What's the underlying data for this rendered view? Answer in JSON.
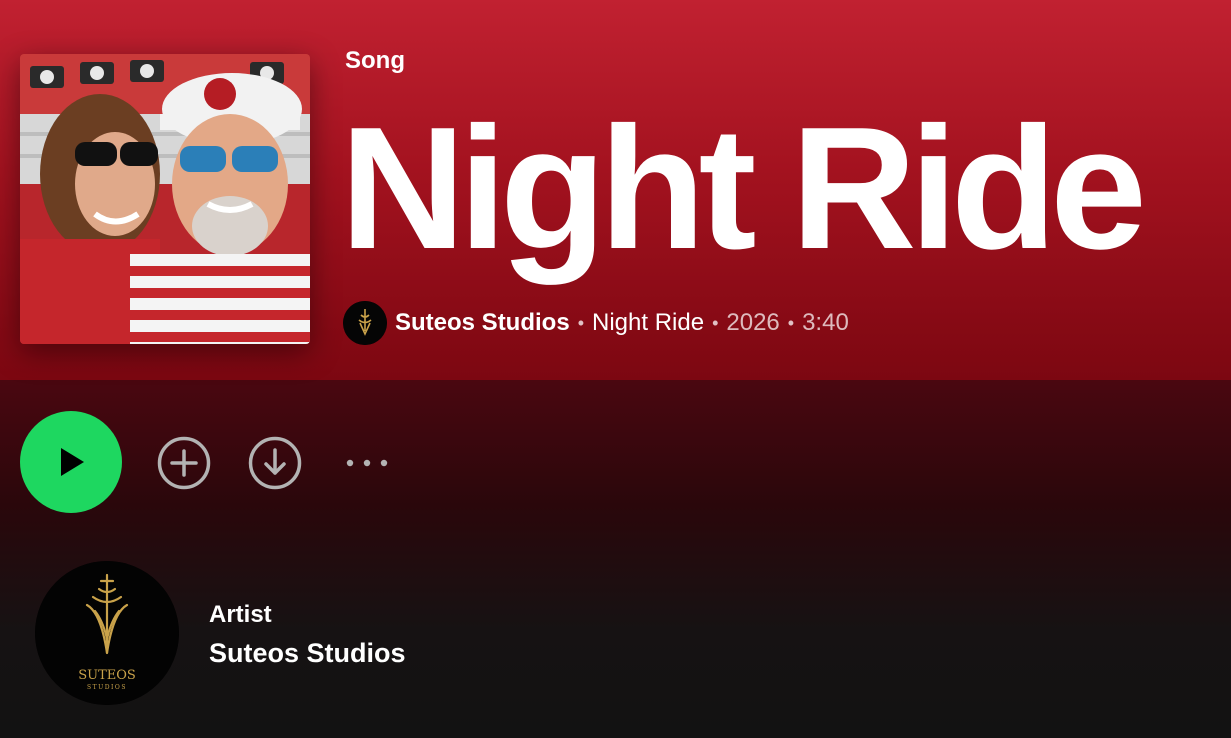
{
  "header": {
    "type_label": "Song",
    "title": "Night Ride",
    "cover_icon": "album-cover-photo"
  },
  "meta": {
    "artist": "Suteos Studios",
    "album": "Night Ride",
    "year": "2026",
    "duration": "3:40",
    "separator": "•"
  },
  "actions": {
    "play_icon": "play-icon",
    "add_icon": "add-circle-icon",
    "download_icon": "download-circle-icon",
    "more_icon": "more-options-icon"
  },
  "artist_section": {
    "role": "Artist",
    "name": "Suteos Studios",
    "logo_text": "SUTEOS",
    "logo_subtext": "STUDIOS"
  },
  "colors": {
    "header_red": "#c12131",
    "play_green": "#1ed760",
    "background": "#121212",
    "logo_gold": "#c9a24a"
  }
}
